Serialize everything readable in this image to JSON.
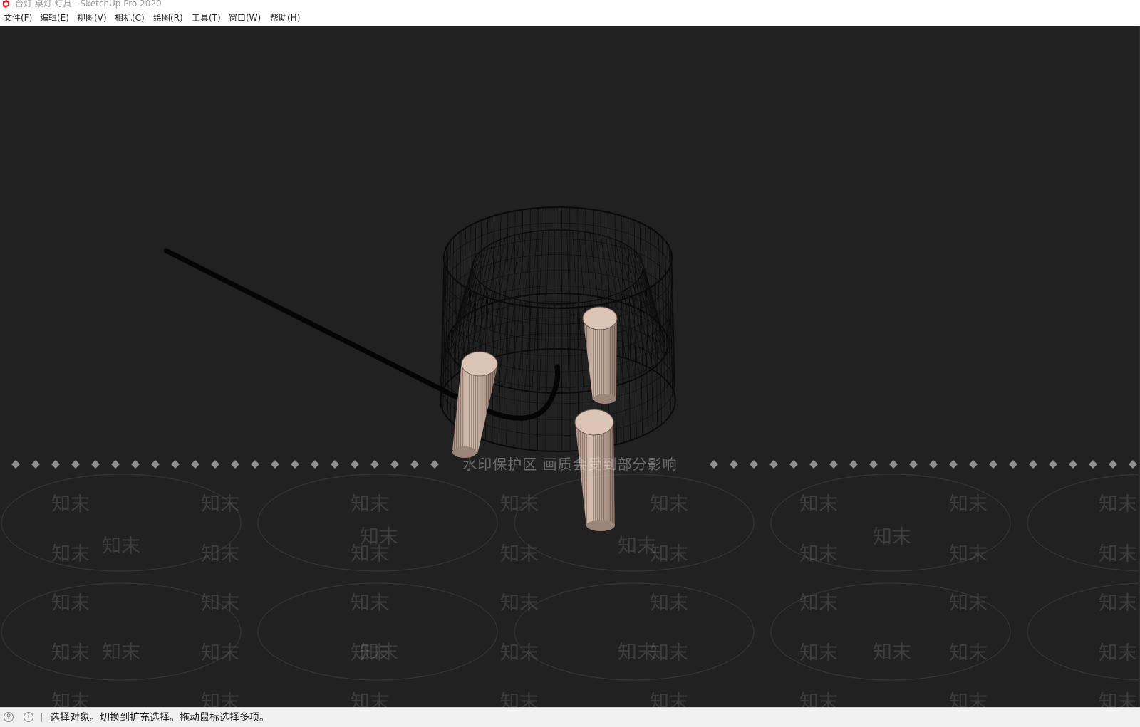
{
  "window": {
    "title": "台灯 桌灯 灯具 - SketchUp Pro 2020",
    "logo_icon": "sketchup-logo-icon",
    "accent": "#d9242a"
  },
  "menu": [
    {
      "label": "文件(F)"
    },
    {
      "label": "编辑(E)"
    },
    {
      "label": "视图(V)"
    },
    {
      "label": "相机(C)"
    },
    {
      "label": "绘图(R)"
    },
    {
      "label": "工具(T)"
    },
    {
      "label": "窗口(W)"
    },
    {
      "label": "帮助(H)"
    }
  ],
  "viewport": {
    "background": "#212121",
    "model": "table-lamp-wireframe",
    "leg_color": "#d9bfb0",
    "cable_color": "#050505"
  },
  "watermark": {
    "banner": "水印保护区  画质会受到部分影响",
    "word": "知末"
  },
  "status": {
    "icons": [
      "geo-location-icon",
      "info-icon"
    ],
    "text": "选择对象。切换到扩充选择。拖动鼠标选择多项。"
  }
}
